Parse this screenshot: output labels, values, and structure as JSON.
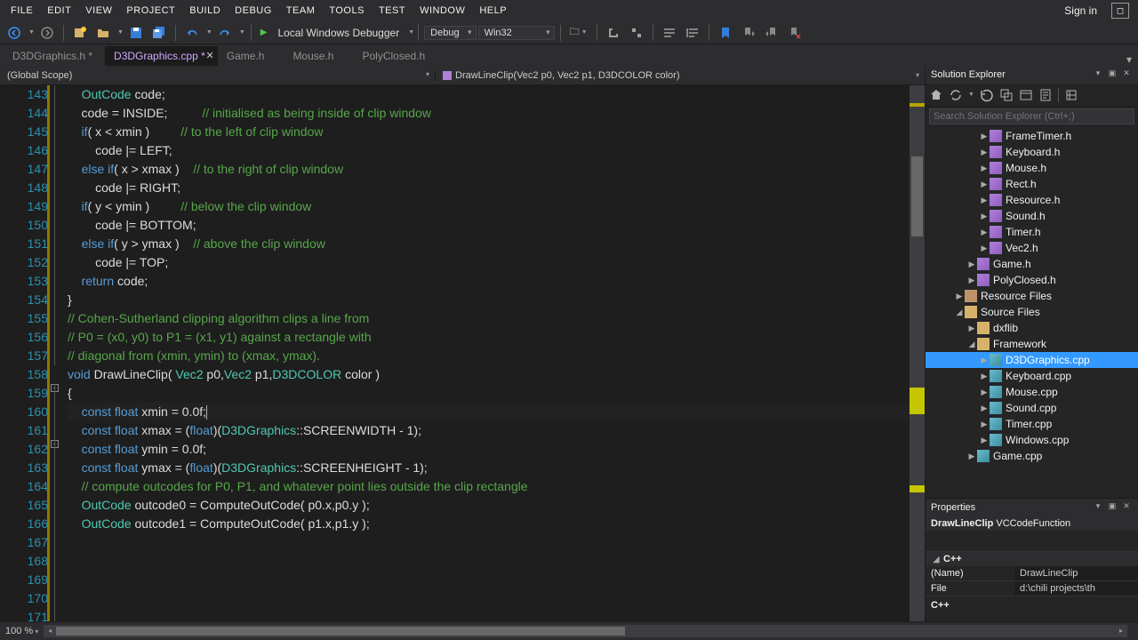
{
  "menu": [
    "FILE",
    "EDIT",
    "VIEW",
    "PROJECT",
    "BUILD",
    "DEBUG",
    "TEAM",
    "TOOLS",
    "TEST",
    "WINDOW",
    "HELP"
  ],
  "signin": "Sign in",
  "debugger_label": "Local Windows Debugger",
  "config_combo": "Debug",
  "platform_combo": "Win32",
  "tabs": [
    {
      "label": "D3DGraphics.h",
      "dirty": true,
      "active": false
    },
    {
      "label": "D3DGraphics.cpp",
      "dirty": true,
      "active": true
    },
    {
      "label": "Game.h",
      "dirty": false,
      "active": false
    },
    {
      "label": "Mouse.h",
      "dirty": false,
      "active": false
    },
    {
      "label": "PolyClosed.h",
      "dirty": false,
      "active": false
    }
  ],
  "scope_combo": "(Global Scope)",
  "func_combo": "DrawLineClip(Vec2 p0, Vec2 p1, D3DCOLOR color)",
  "code_lines": [
    {
      "n": 143,
      "html": "    <span class='ty'>OutCode</span> code;"
    },
    {
      "n": 144,
      "html": ""
    },
    {
      "n": 145,
      "html": "    code = INSIDE;          <span class='cm'>// initialised as being inside of clip window</span>"
    },
    {
      "n": 146,
      "html": ""
    },
    {
      "n": 147,
      "html": "    <span class='kw'>if</span>( x &lt; xmin )         <span class='cm'>// to the left of clip window</span>"
    },
    {
      "n": 148,
      "html": "        code |= LEFT;"
    },
    {
      "n": 149,
      "html": "    <span class='kw'>else if</span>( x &gt; xmax )    <span class='cm'>// to the right of clip window</span>"
    },
    {
      "n": 150,
      "html": "        code |= RIGHT;"
    },
    {
      "n": 151,
      "html": "    <span class='kw'>if</span>( y &lt; ymin )         <span class='cm'>// below the clip window</span>"
    },
    {
      "n": 152,
      "html": "        code |= BOTTOM;"
    },
    {
      "n": 153,
      "html": "    <span class='kw'>else if</span>( y &gt; ymax )    <span class='cm'>// above the clip window</span>"
    },
    {
      "n": 154,
      "html": "        code |= TOP;"
    },
    {
      "n": 155,
      "html": ""
    },
    {
      "n": 156,
      "html": "    <span class='kw'>return</span> code;"
    },
    {
      "n": 157,
      "html": "}"
    },
    {
      "n": 158,
      "html": ""
    },
    {
      "n": 159,
      "html": "<span class='cm'>// Cohen-Sutherland clipping algorithm clips a line from</span>"
    },
    {
      "n": 160,
      "html": "<span class='cm'>// P0 = (x0, y0) to P1 = (x1, y1) against a rectangle with</span>"
    },
    {
      "n": 161,
      "html": "<span class='cm'>// diagonal from (xmin, ymin) to (xmax, ymax).</span>"
    },
    {
      "n": 162,
      "html": "<span class='kw'>void</span> <span class='fn'>DrawLineClip</span>( <span class='ty'>Vec2</span> p0,<span class='ty'>Vec2</span> p1,<span class='ty'>D3DCOLOR</span> color )"
    },
    {
      "n": 163,
      "html": "{"
    },
    {
      "n": 164,
      "html": "    <span class='kw'>const float</span> xmin = 0.0f;",
      "cursor": true
    },
    {
      "n": 165,
      "html": "    <span class='kw'>const float</span> xmax = (<span class='kw'>float</span>)(<span class='ty'>D3DGraphics</span>::SCREENWIDTH - 1);"
    },
    {
      "n": 166,
      "html": "    <span class='kw'>const float</span> ymin = 0.0f;"
    },
    {
      "n": 167,
      "html": "    <span class='kw'>const float</span> ymax = (<span class='kw'>float</span>)(<span class='ty'>D3DGraphics</span>::SCREENHEIGHT - 1);"
    },
    {
      "n": 168,
      "html": ""
    },
    {
      "n": 169,
      "html": "    <span class='cm'>// compute outcodes for P0, P1, and whatever point lies outside the clip rectangle</span>"
    },
    {
      "n": 170,
      "html": "    <span class='ty'>OutCode</span> outcode0 = ComputeOutCode( p0.x,p0.y );"
    },
    {
      "n": 171,
      "html": "    <span class='ty'>OutCode</span> outcode1 = ComputeOutCode( p1.x,p1.y );"
    }
  ],
  "solution_explorer": {
    "title": "Solution Explorer",
    "search_placeholder": "Search Solution Explorer (Ctrl+;)",
    "items": [
      {
        "depth": 4,
        "icon": "h",
        "label": "FrameTimer.h",
        "tw": "▶"
      },
      {
        "depth": 4,
        "icon": "h",
        "label": "Keyboard.h",
        "tw": "▶"
      },
      {
        "depth": 4,
        "icon": "h",
        "label": "Mouse.h",
        "tw": "▶"
      },
      {
        "depth": 4,
        "icon": "h",
        "label": "Rect.h",
        "tw": "▶"
      },
      {
        "depth": 4,
        "icon": "h",
        "label": "Resource.h",
        "tw": "▶"
      },
      {
        "depth": 4,
        "icon": "h",
        "label": "Sound.h",
        "tw": "▶"
      },
      {
        "depth": 4,
        "icon": "h",
        "label": "Timer.h",
        "tw": "▶"
      },
      {
        "depth": 4,
        "icon": "h",
        "label": "Vec2.h",
        "tw": "▶"
      },
      {
        "depth": 3,
        "icon": "h",
        "label": "Game.h",
        "tw": "▶"
      },
      {
        "depth": 3,
        "icon": "h",
        "label": "PolyClosed.h",
        "tw": "▶"
      },
      {
        "depth": 2,
        "icon": "res",
        "label": "Resource Files",
        "tw": "▶"
      },
      {
        "depth": 2,
        "icon": "folder",
        "label": "Source Files",
        "tw": "◢"
      },
      {
        "depth": 3,
        "icon": "folder",
        "label": "dxflib",
        "tw": "▶"
      },
      {
        "depth": 3,
        "icon": "folder",
        "label": "Framework",
        "tw": "◢"
      },
      {
        "depth": 4,
        "icon": "cpp",
        "label": "D3DGraphics.cpp",
        "tw": "▶",
        "sel": true
      },
      {
        "depth": 4,
        "icon": "cpp",
        "label": "Keyboard.cpp",
        "tw": "▶"
      },
      {
        "depth": 4,
        "icon": "cpp",
        "label": "Mouse.cpp",
        "tw": "▶"
      },
      {
        "depth": 4,
        "icon": "cpp",
        "label": "Sound.cpp",
        "tw": "▶"
      },
      {
        "depth": 4,
        "icon": "cpp",
        "label": "Timer.cpp",
        "tw": "▶"
      },
      {
        "depth": 4,
        "icon": "cpp",
        "label": "Windows.cpp",
        "tw": "▶"
      },
      {
        "depth": 3,
        "icon": "cpp",
        "label": "Game.cpp",
        "tw": "▶"
      }
    ]
  },
  "properties": {
    "title": "Properties",
    "header_name": "DrawLineClip",
    "header_type": "VCCodeFunction",
    "category": "C++",
    "rows": [
      {
        "k": "(Name)",
        "v": "DrawLineClip"
      },
      {
        "k": "File",
        "v": "d:\\chili projects\\th"
      }
    ],
    "footer": "C++"
  },
  "zoom": "100 %"
}
